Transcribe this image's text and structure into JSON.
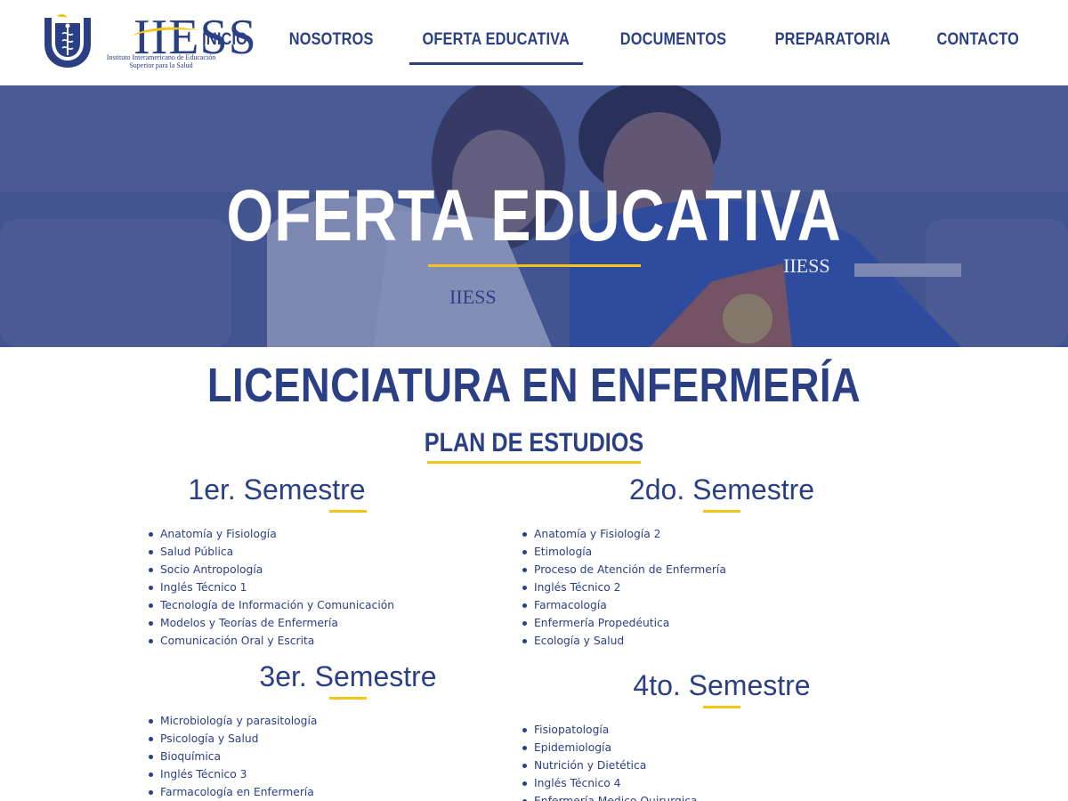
{
  "header": {
    "logo_text": "IIESS",
    "logo_sub_line1": "Instituto Interamericano de Educación",
    "logo_sub_line2": "Superior para la Salud",
    "nav": [
      {
        "label": "INICIO",
        "active": false
      },
      {
        "label": "NOSOTROS",
        "active": false
      },
      {
        "label": "OFERTA EDUCATIVA",
        "active": true
      },
      {
        "label": "DOCUMENTOS",
        "active": false
      },
      {
        "label": "PREPARATORIA",
        "active": false
      },
      {
        "label": "CONTACTO",
        "active": false
      }
    ]
  },
  "hero": {
    "title": "OFERTA EDUCATIVA",
    "photo_logo_text": "IIESS"
  },
  "main": {
    "title": "LICENCIATURA EN ENFERMERÍA",
    "plan_title": "PLAN DE ESTUDIOS",
    "semesters": [
      {
        "title": "1er. Semestre",
        "subjects": [
          "Anatomía y Fisiología",
          "Salud Pública",
          "Socio Antropología",
          "Inglés Técnico 1",
          "Tecnología de Información y Comunicación",
          "Modelos y Teorías de Enfermería",
          "Comunicación Oral y Escrita"
        ]
      },
      {
        "title": "2do. Semestre",
        "subjects": [
          "Anatomía y Fisiología 2",
          "Etimología",
          "Proceso de Atención de Enfermería",
          "Inglés Técnico 2",
          "Farmacología",
          "Enfermería Propedéutica",
          "Ecología y Salud"
        ]
      },
      {
        "title": "3er. Semestre",
        "subjects": [
          "Microbiología y parasitología",
          "Psicología y Salud",
          "Bioquímica",
          "Inglés Técnico 3",
          "Farmacología en Enfermería"
        ]
      },
      {
        "title": "4to. Semestre",
        "subjects": [
          "Fisiopatología",
          "Epidemiología",
          "Nutrición y Dietética",
          "Inglés Técnico 4",
          "Enfermería Medico Quirurgica"
        ]
      }
    ]
  },
  "colors": {
    "primary": "#2b3f85",
    "accent": "#f4c418",
    "hero_overlay": "#3c4f8f"
  }
}
